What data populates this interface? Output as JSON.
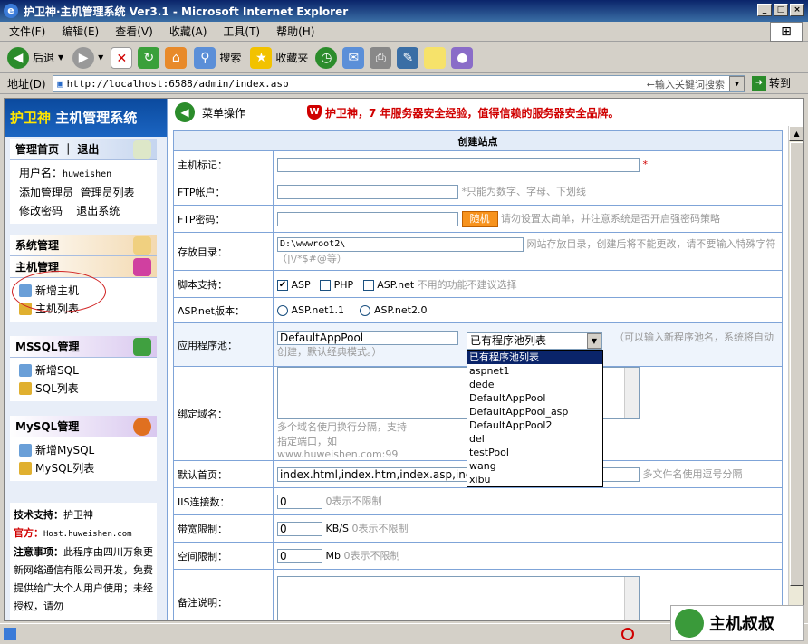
{
  "window": {
    "title": "护卫神·主机管理系统 Ver3.1 - Microsoft Internet Explorer",
    "min": "_",
    "max": "□",
    "close": "×"
  },
  "menu": [
    "文件(F)",
    "编辑(E)",
    "查看(V)",
    "收藏(A)",
    "工具(T)",
    "帮助(H)"
  ],
  "toolbar": {
    "back": "后退",
    "search": "搜索",
    "favorites": "收藏夹"
  },
  "address": {
    "label": "地址(D)",
    "url": "http://localhost:6588/admin/index.asp",
    "hint": "←输入关键词搜索",
    "go": "转到"
  },
  "sidebar": {
    "brand_a": "护卫神",
    "brand_b": "主机管理系统",
    "home": "管理首页",
    "logout": "退出",
    "user_label": "用户名：",
    "user": "huweishen",
    "add_admin": "添加管理员",
    "admin_list": "管理员列表",
    "change_pw": "修改密码",
    "exit_sys": "退出系统",
    "sys_mgmt": "系统管理",
    "host_mgmt": "主机管理",
    "new_host": "新增主机",
    "host_list": "主机列表",
    "mssql": "MSSQL管理",
    "new_sql": "新增SQL",
    "sql_list": "SQL列表",
    "mysql": "MySQL管理",
    "new_mysql": "新增MySQL",
    "mysql_list": "MySQL列表",
    "support_label": "技术支持：",
    "support": "护卫神",
    "site_label": "官方：",
    "site": "Host.huweishen.com",
    "note_label": "注意事项：",
    "note": "此程序由四川万象更新网络通信有限公司开发，免费提供给广大个人用户使用；未经授权，请勿"
  },
  "main": {
    "menu_op": "菜单操作",
    "tagline": "护卫神，7 年服务器安全经验，值得信赖的服务器安全品牌。",
    "caption": "创建站点",
    "host_tag": "主机标记：",
    "required": "*",
    "ftp_user": "FTP帐户：",
    "ftp_user_hint": "*只能为数字、字母、下划线",
    "ftp_pw": "FTP密码：",
    "rand": "随机",
    "ftp_pw_hint": "请勿设置太简单，并注意系统是否开启强密码策略",
    "dir": "存放目录：",
    "dir_value": "D:\\wwwroot2\\",
    "dir_hint": "网站存放目录，创建后将不能更改，请不要输入特殊字符（|\\/*$#@等）",
    "script": "脚本支持：",
    "asp": "ASP",
    "php": "PHP",
    "aspnet": "ASP.net",
    "script_hint": "不用的功能不建议选择",
    "aspnet_ver": "ASP.net版本：",
    "net11": "ASP.net1.1",
    "net20": "ASP.net2.0",
    "pool": "应用程序池：",
    "pool_value": "DefaultAppPool",
    "pool_select": "已有程序池列表",
    "pool_hint": "（可以输入新程序池名，系统将自动创建，默认经典模式。）",
    "pool_options": [
      "已有程序池列表",
      "aspnet1",
      "dede",
      "DefaultAppPool",
      "DefaultAppPool_asp",
      "DefaultAppPool2",
      "del",
      "testPool",
      "wang",
      "xibu"
    ],
    "domain": "绑定域名：",
    "domain_hint": "多个域名使用换行分隔，支持指定端口，如 www.huweishen.com:99",
    "index": "默认首页：",
    "index_value": "index.html,index.htm,index.asp,index.aspx,default.html",
    "index_hint": "多文件名使用逗号分隔",
    "iis": "IIS连接数：",
    "iis_value": "0",
    "iis_hint": "0表示不限制",
    "bw": "带宽限制：",
    "bw_value": "0",
    "bw_unit": "KB/S",
    "bw_hint": "0表示不限制",
    "space": "空间限制：",
    "space_value": "0",
    "space_unit": "Mb",
    "space_hint": "0表示不限制",
    "remark": "备注说明："
  },
  "watermark": "主机叔叔"
}
